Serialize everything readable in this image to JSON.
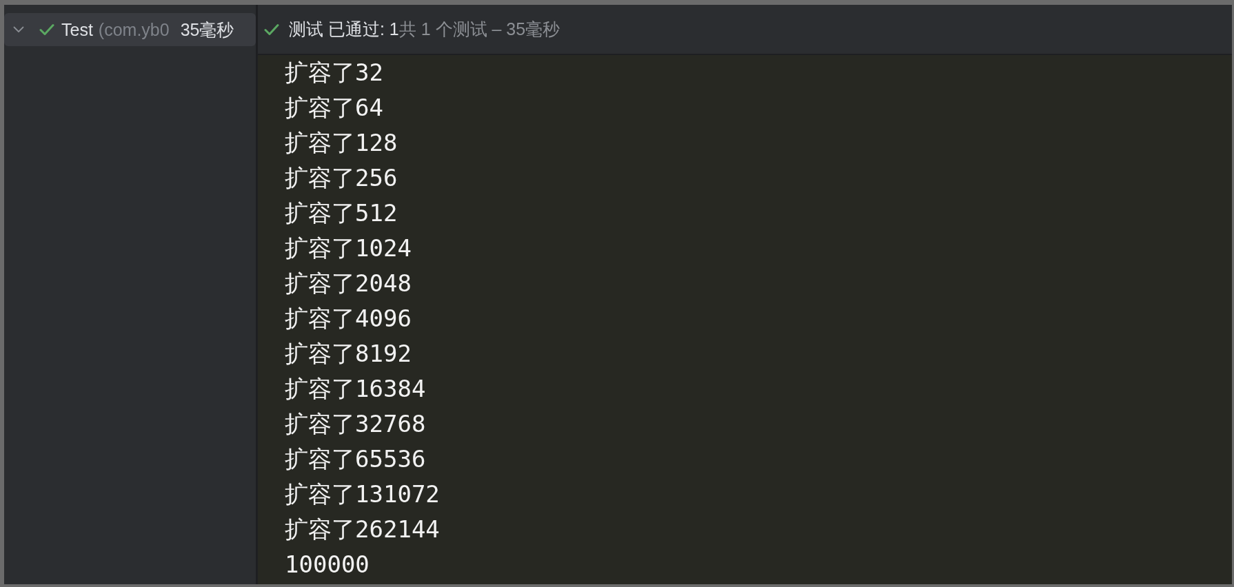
{
  "sidebar": {
    "items": [
      {
        "expanded": true,
        "passed": true,
        "selected": true,
        "name": "Test",
        "detail": "(com.yb0",
        "duration": "35毫秒"
      }
    ]
  },
  "header": {
    "passed": true,
    "title": "测试 已通过: 1",
    "summary": "共 1 个测试 – 35毫秒"
  },
  "console": {
    "lines": [
      "扩容了32",
      "扩容了64",
      "扩容了128",
      "扩容了256",
      "扩容了512",
      "扩容了1024",
      "扩容了2048",
      "扩容了4096",
      "扩容了8192",
      "扩容了16384",
      "扩容了32768",
      "扩容了65536",
      "扩容了131072",
      "扩容了262144",
      "100000"
    ]
  }
}
